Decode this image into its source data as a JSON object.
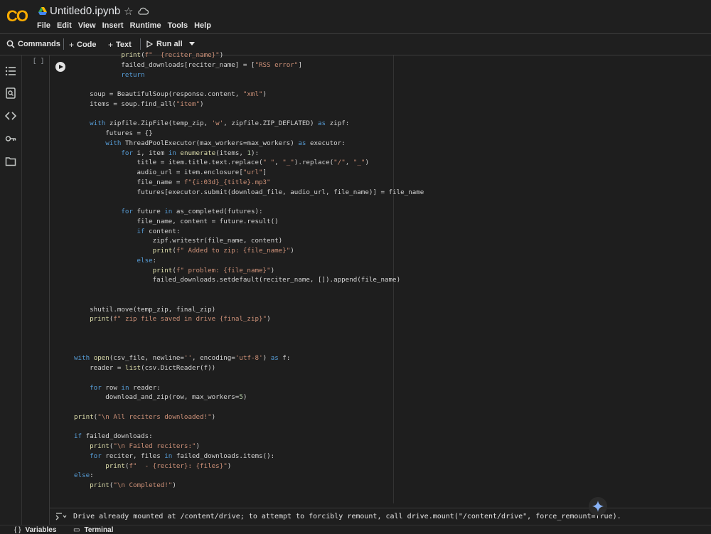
{
  "header": {
    "logo_text": "CO",
    "title": "Untitled0.ipynb",
    "menu": [
      "File",
      "Edit",
      "View",
      "Insert",
      "Runtime",
      "Tools",
      "Help"
    ]
  },
  "toolbar": {
    "commands": "Commands",
    "code": "Code",
    "text": "Text",
    "run_all": "Run all"
  },
  "cell": {
    "exec_count": "[ ]",
    "output": "Drive already mounted at /content/drive; to attempt to forcibly remount, call drive.mount(\"/content/drive\", force_remount=True)."
  },
  "bottom": {
    "variables": "Variables",
    "terminal": "Terminal"
  },
  "colors": {
    "background": "#1e1e1e",
    "logo_orange": "#f9ab00",
    "keyword": "#569cd6",
    "string": "#ce9178",
    "function": "#dcdcaa",
    "gemini": "#8ab4f8"
  },
  "icons": [
    "drive-icon",
    "star-icon",
    "cloud-sync-icon",
    "search-icon",
    "plus-icon",
    "play-icon",
    "chevron-down-icon",
    "toc-icon",
    "find-icon",
    "code-snippets-icon",
    "key-icon",
    "folder-icon",
    "run-cell-icon",
    "output-icon",
    "gemini-icon",
    "braces-icon",
    "terminal-icon"
  ]
}
